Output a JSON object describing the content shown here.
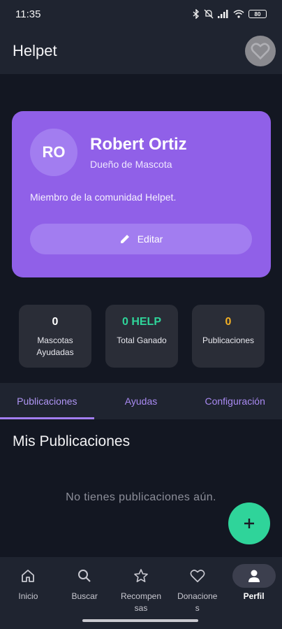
{
  "status_bar": {
    "time": "11:35",
    "battery": "80"
  },
  "app_bar": {
    "title": "Helpet"
  },
  "profile": {
    "initials": "RO",
    "name": "Robert Ortiz",
    "role": "Dueño de Mascota",
    "description": "Miembro de la comunidad Helpet.",
    "edit_label": "Editar"
  },
  "stats": [
    {
      "value": "0",
      "label": "Mascotas Ayudadas",
      "color": "#ffffff"
    },
    {
      "value": "0 HELP",
      "label": "Total Ganado",
      "color": "#2fd49a"
    },
    {
      "value": "0",
      "label": "Publicaciones",
      "color": "#f2b025"
    }
  ],
  "tabs": [
    {
      "label": "Publicaciones",
      "active": true
    },
    {
      "label": "Ayudas",
      "active": false
    },
    {
      "label": "Configuración",
      "active": false
    }
  ],
  "section": {
    "title": "Mis Publicaciones",
    "empty_text": "No tienes publicaciones aún."
  },
  "bottom_nav": [
    {
      "label": "Inicio",
      "icon": "home-icon"
    },
    {
      "label": "Buscar",
      "icon": "search-icon"
    },
    {
      "label": "Recompensas",
      "icon": "star-icon"
    },
    {
      "label": "Donaciones",
      "icon": "heart-icon"
    },
    {
      "label": "Perfil",
      "icon": "person-icon",
      "active": true
    }
  ],
  "colors": {
    "accent": "#9060e8",
    "success": "#2fd49a",
    "warning": "#f2b025"
  }
}
